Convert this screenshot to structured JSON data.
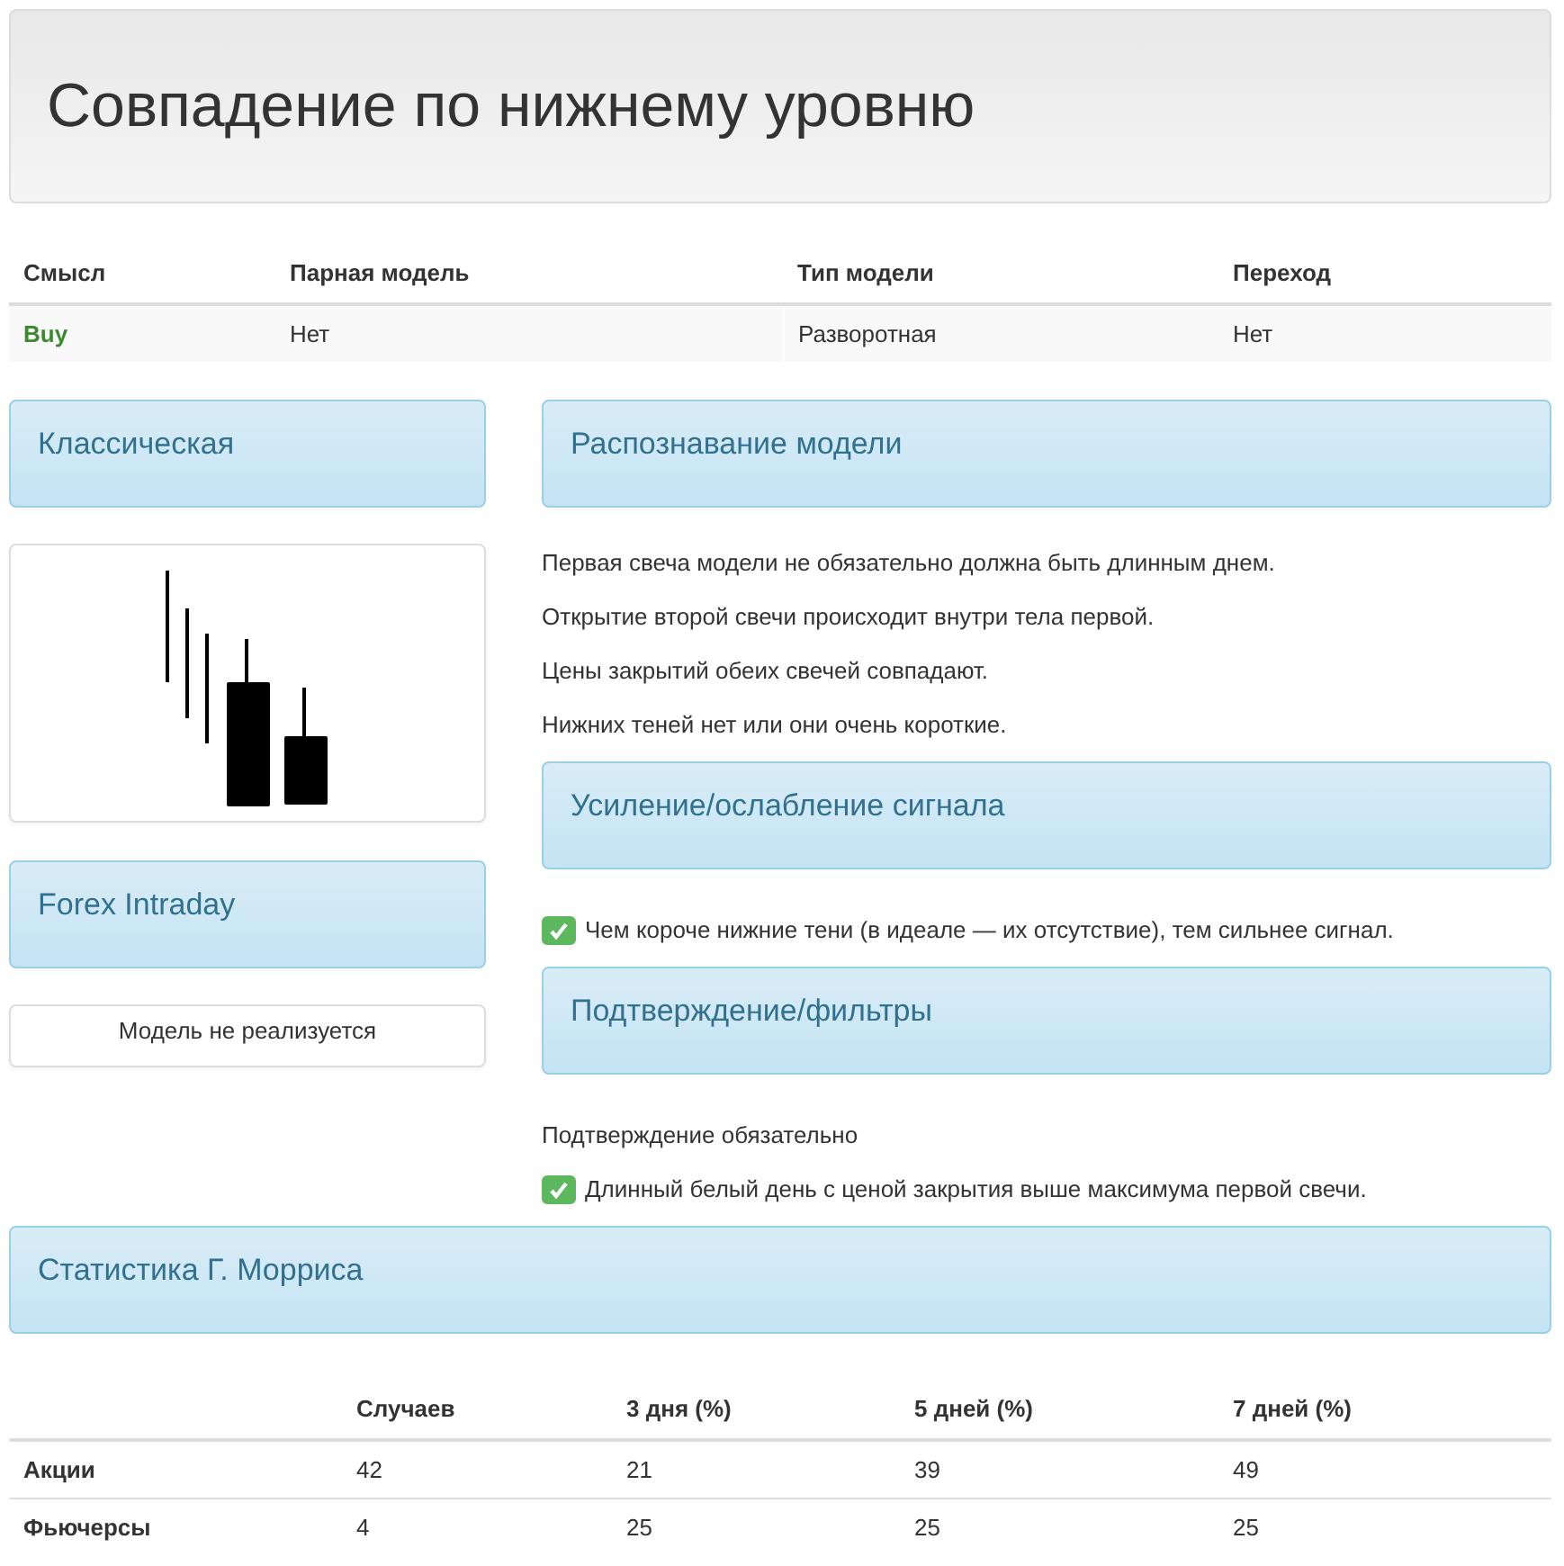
{
  "title": "Совпадение по нижнему уровню",
  "summary": {
    "columns": [
      "Смысл",
      "Парная модель",
      "Тип модели",
      "Переход"
    ],
    "rows": [
      {
        "cells": [
          "Buy",
          "Нет",
          "Разворотная",
          "Нет"
        ]
      }
    ]
  },
  "left": [
    {
      "title": "Классическая",
      "kind": "picture"
    },
    {
      "title": "Forex Intraday",
      "kind": "note",
      "text": "Модель не реализуется"
    }
  ],
  "right": [
    {
      "title": "Распознавание модели",
      "items": [
        {
          "kind": "text",
          "text": "Первая свеча модели не обязательно должна быть длинным днем."
        },
        {
          "kind": "text",
          "text": "Открытие второй свечи происходит внутри тела первой."
        },
        {
          "kind": "text",
          "text": "Цены закрытий обеих свечей совпадают."
        },
        {
          "kind": "text",
          "text": "Нижних теней нет или они очень короткие."
        }
      ]
    },
    {
      "title": "Усиление/ослабление сигнала",
      "items": [
        {
          "kind": "check",
          "checked": true,
          "text": "Чем короче нижние тени (в идеале — их отсутствие), тем сильнее сигнал."
        }
      ]
    },
    {
      "title": "Подтверждение/фильтры",
      "items": [
        {
          "kind": "text",
          "text": "Подтверждение обязательно"
        },
        {
          "kind": "check",
          "checked": true,
          "text": "Длинный белый день с ценой закрытия выше максимума первой свечи."
        }
      ]
    }
  ],
  "stats": {
    "title": "Статистика Г. Морриса",
    "columns": [
      "Случаев",
      "3 дня (%)",
      "5 дней (%)",
      "7 дней (%)"
    ],
    "rows": [
      {
        "label": "Акции",
        "values": [
          "42",
          "21",
          "39",
          "49"
        ]
      },
      {
        "label": "Фьючерсы",
        "values": [
          "4",
          "25",
          "25",
          "25"
        ]
      }
    ]
  }
}
